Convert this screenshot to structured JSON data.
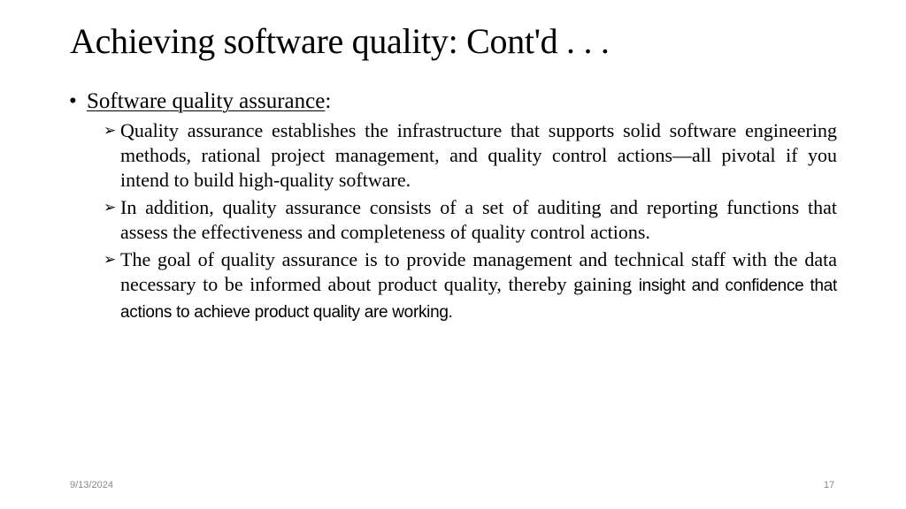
{
  "slide": {
    "title": "Achieving software quality: Cont'd . . .",
    "heading": {
      "bullet": "•",
      "label": "Software quality assurance",
      "suffix": ":"
    },
    "points": [
      {
        "marker": "➢",
        "text": "Quality assurance establishes the infrastructure that supports solid software engineering methods, rational project management, and quality control actions—all pivotal if you intend to build high-quality software."
      },
      {
        "marker": "➢",
        "text": "In addition, quality assurance consists of a set of auditing and reporting functions that assess the effectiveness and completeness of quality control actions."
      },
      {
        "marker": "➢",
        "text_serif": "The goal of quality assurance is to provide management and technical staff with the data necessary to be informed about product quality, thereby gaining",
        "text_sans": "insight and confidence that actions to achieve product quality are working."
      }
    ]
  },
  "footer": {
    "date": "9/13/2024",
    "page_number": "17"
  }
}
